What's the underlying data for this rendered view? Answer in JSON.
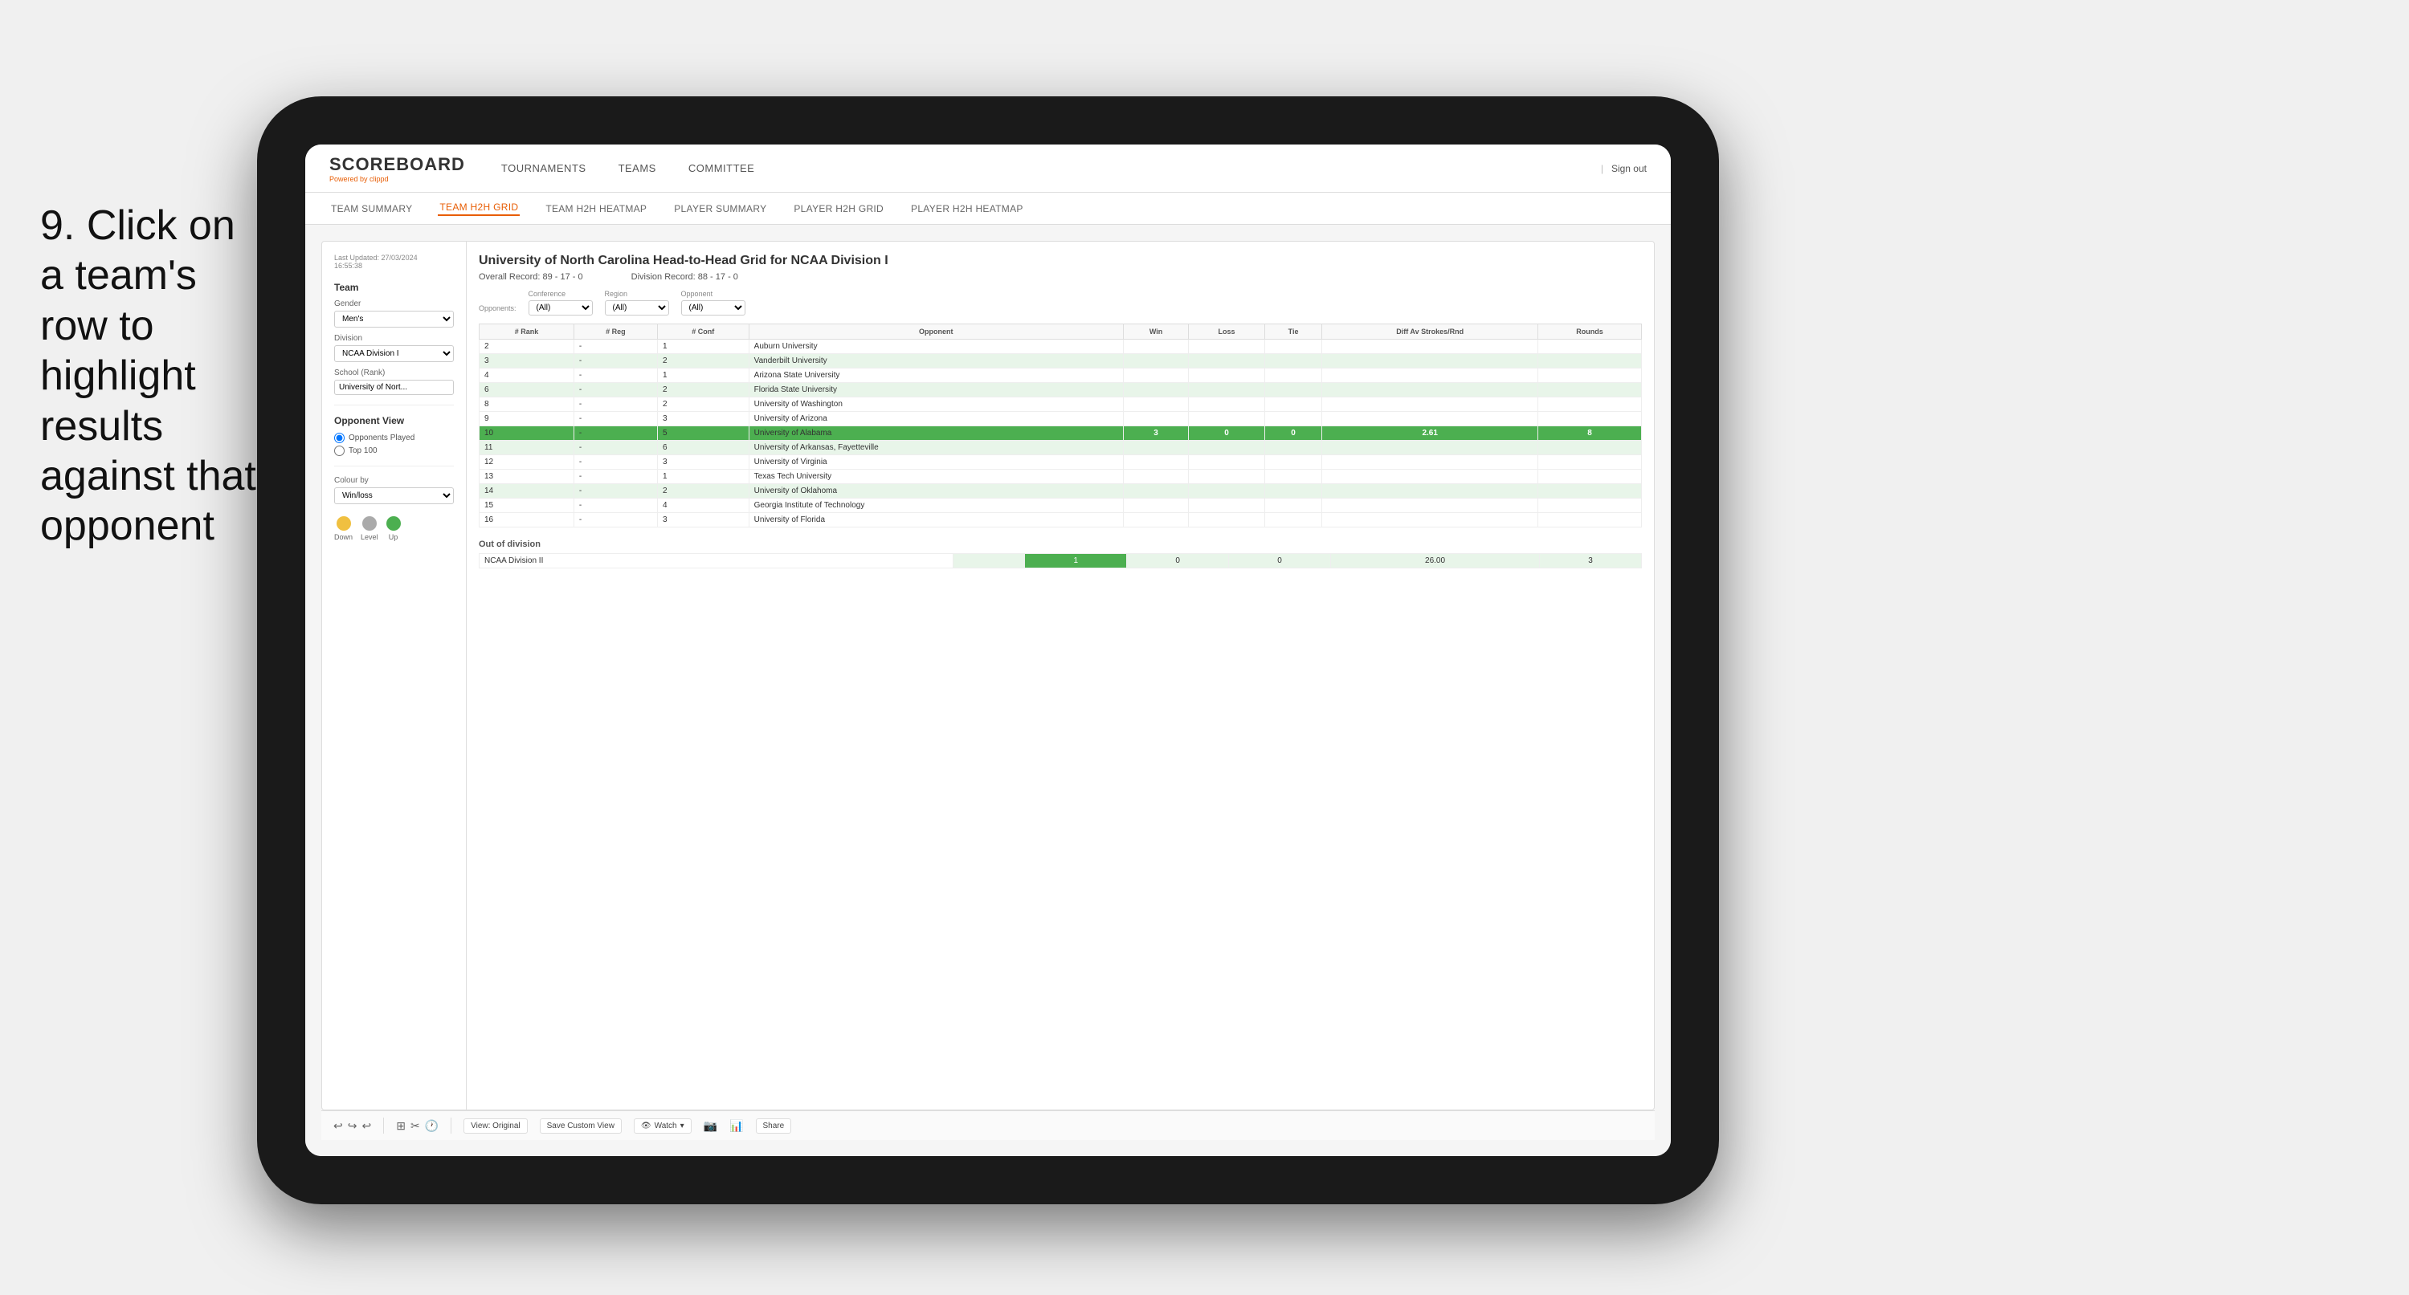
{
  "instruction": {
    "number": "9.",
    "text": "Click on a team's row to highlight results against that opponent"
  },
  "nav": {
    "logo": "SCOREBOARD",
    "powered_by": "Powered by",
    "powered_brand": "clippd",
    "items": [
      "TOURNAMENTS",
      "TEAMS",
      "COMMITTEE"
    ],
    "sign_out": "Sign out"
  },
  "sub_nav": {
    "items": [
      "TEAM SUMMARY",
      "TEAM H2H GRID",
      "TEAM H2H HEATMAP",
      "PLAYER SUMMARY",
      "PLAYER H2H GRID",
      "PLAYER H2H HEATMAP"
    ],
    "active": "TEAM H2H GRID"
  },
  "sidebar": {
    "timestamp_label": "Last Updated: 27/03/2024",
    "time": "16:55:38",
    "team_label": "Team",
    "gender_label": "Gender",
    "gender_value": "Men's",
    "division_label": "Division",
    "division_value": "NCAA Division I",
    "school_label": "School (Rank)",
    "school_value": "University of Nort...",
    "opponent_view_label": "Opponent View",
    "radio_opponents": "Opponents Played",
    "radio_top100": "Top 100",
    "colour_by_label": "Colour by",
    "colour_by_value": "Win/loss",
    "legend": [
      {
        "label": "Down",
        "color": "down"
      },
      {
        "label": "Level",
        "color": "level"
      },
      {
        "label": "Up",
        "color": "up"
      }
    ]
  },
  "main": {
    "title": "University of North Carolina Head-to-Head Grid for NCAA Division I",
    "overall_record": "Overall Record: 89 - 17 - 0",
    "division_record": "Division Record: 88 - 17 - 0",
    "filters": {
      "opponents_label": "Opponents:",
      "conference_label": "Conference",
      "conference_value": "(All)",
      "region_label": "Region",
      "region_value": "(All)",
      "opponent_label": "Opponent",
      "opponent_value": "(All)"
    },
    "table_headers": [
      "# Rank",
      "# Reg",
      "# Conf",
      "Opponent",
      "Win",
      "Loss",
      "Tie",
      "Diff Av Strokes/Rnd",
      "Rounds"
    ],
    "rows": [
      {
        "rank": "2",
        "reg": "-",
        "conf": "1",
        "opponent": "Auburn University",
        "win": "",
        "loss": "",
        "tie": "",
        "diff": "",
        "rounds": "",
        "style": "normal"
      },
      {
        "rank": "3",
        "reg": "-",
        "conf": "2",
        "opponent": "Vanderbilt University",
        "win": "",
        "loss": "",
        "tie": "",
        "diff": "",
        "rounds": "",
        "style": "light-green"
      },
      {
        "rank": "4",
        "reg": "-",
        "conf": "1",
        "opponent": "Arizona State University",
        "win": "",
        "loss": "",
        "tie": "",
        "diff": "",
        "rounds": "",
        "style": "normal"
      },
      {
        "rank": "6",
        "reg": "-",
        "conf": "2",
        "opponent": "Florida State University",
        "win": "",
        "loss": "",
        "tie": "",
        "diff": "",
        "rounds": "",
        "style": "light-green"
      },
      {
        "rank": "8",
        "reg": "-",
        "conf": "2",
        "opponent": "University of Washington",
        "win": "",
        "loss": "",
        "tie": "",
        "diff": "",
        "rounds": "",
        "style": "normal"
      },
      {
        "rank": "9",
        "reg": "-",
        "conf": "3",
        "opponent": "University of Arizona",
        "win": "",
        "loss": "",
        "tie": "",
        "diff": "",
        "rounds": "",
        "style": "normal"
      },
      {
        "rank": "10",
        "reg": "-",
        "conf": "5",
        "opponent": "University of Alabama",
        "win": "3",
        "loss": "0",
        "tie": "0",
        "diff": "2.61",
        "rounds": "8",
        "style": "highlighted"
      },
      {
        "rank": "11",
        "reg": "-",
        "conf": "6",
        "opponent": "University of Arkansas, Fayetteville",
        "win": "",
        "loss": "",
        "tie": "",
        "diff": "",
        "rounds": "",
        "style": "light-green"
      },
      {
        "rank": "12",
        "reg": "-",
        "conf": "3",
        "opponent": "University of Virginia",
        "win": "",
        "loss": "",
        "tie": "",
        "diff": "",
        "rounds": "",
        "style": "normal"
      },
      {
        "rank": "13",
        "reg": "-",
        "conf": "1",
        "opponent": "Texas Tech University",
        "win": "",
        "loss": "",
        "tie": "",
        "diff": "",
        "rounds": "",
        "style": "normal"
      },
      {
        "rank": "14",
        "reg": "-",
        "conf": "2",
        "opponent": "University of Oklahoma",
        "win": "",
        "loss": "",
        "tie": "",
        "diff": "",
        "rounds": "",
        "style": "light-green"
      },
      {
        "rank": "15",
        "reg": "-",
        "conf": "4",
        "opponent": "Georgia Institute of Technology",
        "win": "",
        "loss": "",
        "tie": "",
        "diff": "",
        "rounds": "",
        "style": "normal"
      },
      {
        "rank": "16",
        "reg": "-",
        "conf": "3",
        "opponent": "University of Florida",
        "win": "",
        "loss": "",
        "tie": "",
        "diff": "",
        "rounds": "",
        "style": "normal"
      }
    ],
    "out_of_division_label": "Out of division",
    "out_div_row": {
      "division": "NCAA Division II",
      "win": "1",
      "loss": "0",
      "tie": "0",
      "diff": "26.00",
      "rounds": "3"
    }
  },
  "toolbar": {
    "view_label": "View: Original",
    "save_custom": "Save Custom View",
    "watch": "Watch",
    "share": "Share"
  }
}
